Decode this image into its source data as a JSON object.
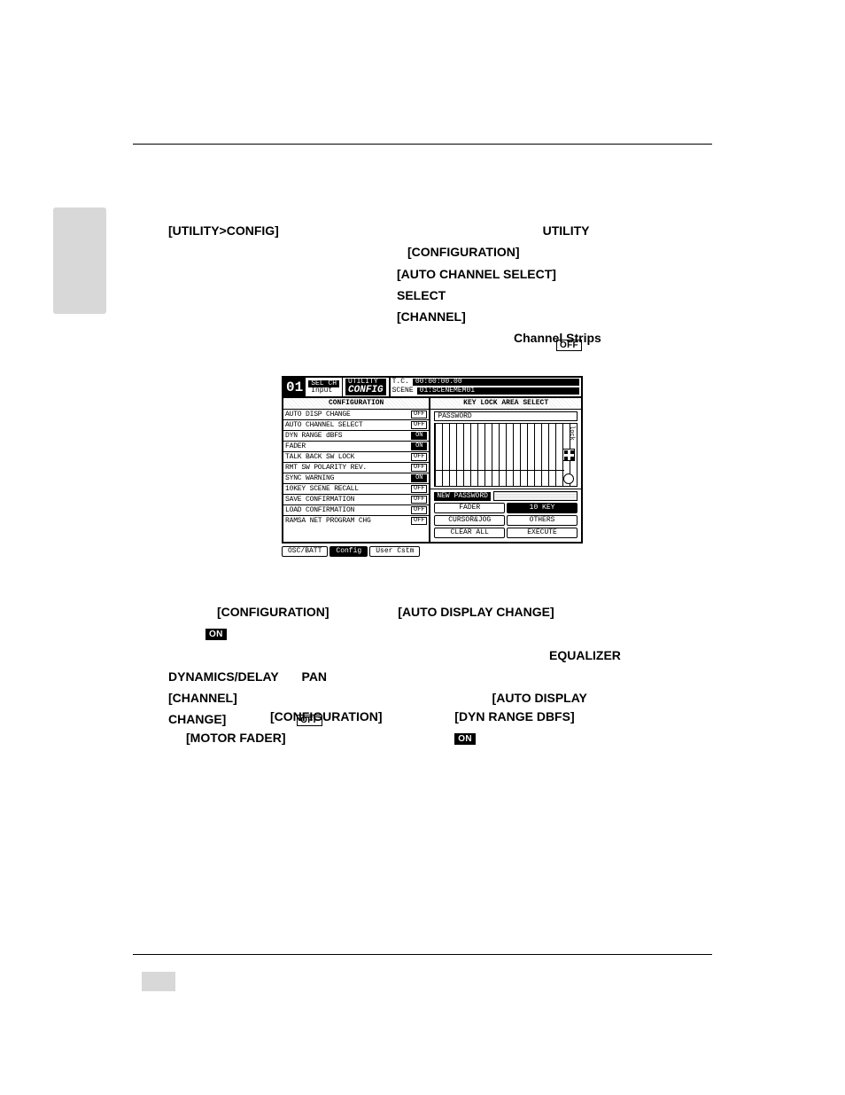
{
  "badges": {
    "on": "ON",
    "off": "OFF"
  },
  "intro": {
    "screen_ref": "[UTILITY>CONFIG]",
    "utility_word": "UTILITY",
    "configuration": "[CONFIGURATION]",
    "auto_ch_sel": "[AUTO CHANNEL SELECT]",
    "select_word": "SELECT",
    "channel_word": "[CHANNEL]",
    "channel_strips": "Channel Strips"
  },
  "lcd": {
    "top": {
      "index": "01",
      "sel_ch_label": "SEL CH",
      "sel_ch_value": "Input",
      "util_label": "UTILITY",
      "config_label": "CONFIG",
      "tc_label": "T.C.",
      "tc_value": "00:00:00.00",
      "scene_label": "SCENE",
      "scene_value": "01:SCENEMEM01"
    },
    "left_title": "CONFIGURATION",
    "config_items": [
      {
        "name": "AUTO DISP CHANGE",
        "state": "OFF",
        "on": false
      },
      {
        "name": "AUTO CHANNEL SELECT",
        "state": "OFF",
        "on": false
      },
      {
        "name": "DYN RANGE dBFS",
        "state": "ON",
        "on": true
      },
      {
        "name": "FADER",
        "state": "ON",
        "on": true
      },
      {
        "name": "TALK BACK SW LOCK",
        "state": "OFF",
        "on": false
      },
      {
        "name": "RMT SW POLARITY REV.",
        "state": "OFF",
        "on": false
      },
      {
        "name": "SYNC WARNING",
        "state": "ON",
        "on": true
      },
      {
        "name": "10KEY SCENE RECALL",
        "state": "OFF",
        "on": false
      },
      {
        "name": "SAVE CONFIRMATION",
        "state": "OFF",
        "on": false
      },
      {
        "name": "LOAD CONFIRMATION",
        "state": "OFF",
        "on": false
      },
      {
        "name": "RAMSA NET PROGRAM CHG",
        "state": "OFF",
        "on": false
      }
    ],
    "right_title": "KEY LOCK AREA SELECT",
    "password_label": "PASSWORD",
    "new_password_label": "NEW PASSWORD",
    "lock_text": "lock",
    "buttons": {
      "fader": "FADER",
      "tenkey": "10 KEY",
      "cursor": "CURSOR&JOG",
      "others": "OTHERS",
      "clear": "CLEAR ALL",
      "execute": "EXECUTE"
    },
    "tabs": {
      "osc": "OSC/BATT",
      "config": "Config",
      "user": "User Cstm"
    }
  },
  "para3": {
    "configuration": "[CONFIGURATION]",
    "auto_disp_change": "[AUTO DISPLAY CHANGE]",
    "equalizer": "EQUALIZER",
    "dyn_delay": "DYNAMICS/DELAY",
    "pan": "PAN",
    "channel": "[CHANNEL]",
    "auto_display": "[AUTO DISPLAY",
    "change_close": "CHANGE]"
  },
  "para4": {
    "configuration": "[CONFIGURATION]",
    "dyn_range": "[DYN RANGE DBFS]",
    "motor_fader": "[MOTOR FADER]"
  }
}
